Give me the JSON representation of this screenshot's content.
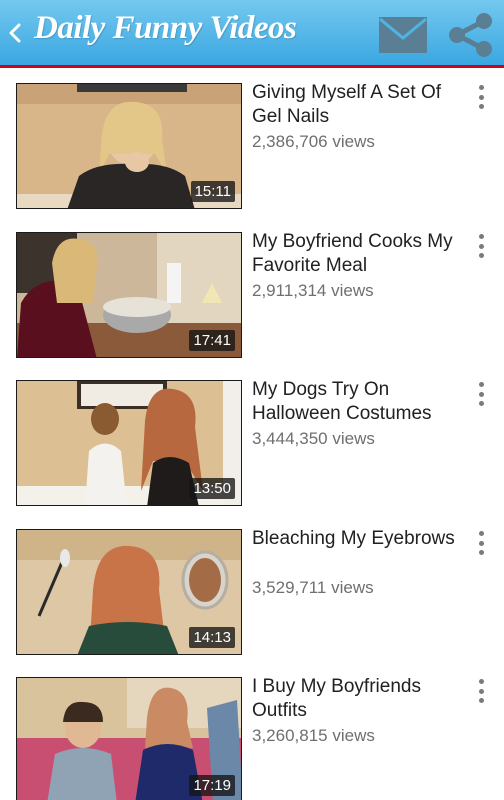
{
  "header": {
    "title": "Daily Funny Videos",
    "back_icon": "chevron-left-icon",
    "mail_icon": "envelope-icon",
    "share_icon": "share-icon",
    "bar_color": "#4fb3e6",
    "accent_line_color": "#d0021b"
  },
  "videos": [
    {
      "title": "Giving Myself A Set Of Gel Nails",
      "views": "2,386,706 views",
      "duration": "15:11"
    },
    {
      "title": "My Boyfriend Cooks My Favorite Meal",
      "views": "2,911,314 views",
      "duration": "17:41"
    },
    {
      "title": "My Dogs Try On Halloween Costumes",
      "views": "3,444,350 views",
      "duration": "13:50"
    },
    {
      "title": "Bleaching My Eyebrows",
      "views": "3,529,711 views",
      "duration": "14:13"
    },
    {
      "title": "I Buy My Boyfriends Outfits",
      "views": "3,260,815 views",
      "duration": "17:19"
    }
  ]
}
